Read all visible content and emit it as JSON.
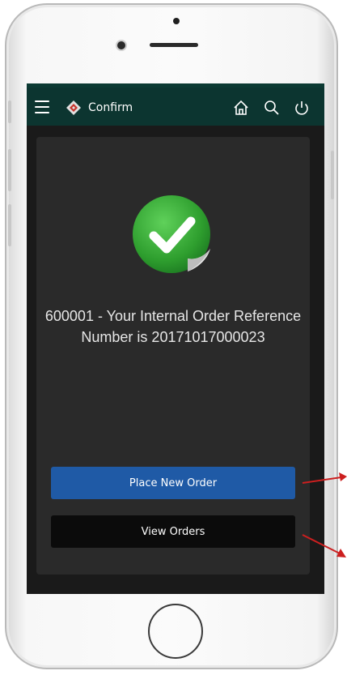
{
  "header": {
    "title": "Confirm",
    "icons": [
      "menu-icon",
      "brand-logo-icon",
      "home-icon",
      "search-icon",
      "power-icon"
    ]
  },
  "confirmation": {
    "message": "600001 - Your Internal Order Reference Number is 20171017000023",
    "status_icon": "check-icon",
    "accent": "#3fae3f"
  },
  "actions": {
    "place_new_order": "Place New Order",
    "view_orders": "View Orders"
  },
  "colors": {
    "header_bg": "#0c3530",
    "screen_bg": "#1a1a1a",
    "card_bg": "#2a2a2a",
    "primary_button": "#1f5aa6",
    "secondary_button": "#0b0b0b",
    "annotation_arrow": "#cc1f1f"
  }
}
